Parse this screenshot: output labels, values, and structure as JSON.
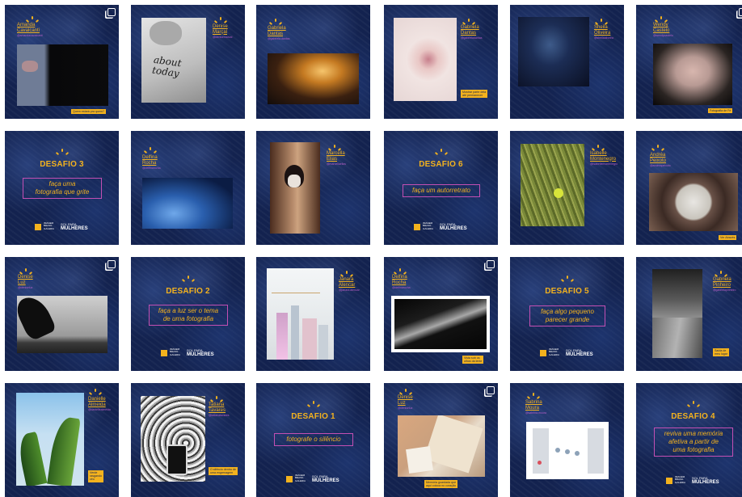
{
  "tiles": {
    "t1": {
      "name": "Amanda\nCavalcanti",
      "handle": "@amandacavalcanti",
      "caption": "Quem estará pra quem?"
    },
    "t2": {
      "name": "Denise\nMarçal",
      "handle": "@denisemarcal",
      "shirt_text": "about\ntoday"
    },
    "t3": {
      "name": "Gabriela\nDantas",
      "handle": "@gabriela.dantas"
    },
    "t4": {
      "name": "Gabriela\nDantas",
      "handle": "@gabrieladantas",
      "caption": "Mostrar parte dela\naté permanecer"
    },
    "t5": {
      "name": "Sheila\nOliveira",
      "handle": "@sheilaoliveira"
    },
    "t6": {
      "name": "Wendy\nCastelo",
      "handle": "@wendycastelo",
      "caption": "Fotografia de Fé"
    },
    "t7": {
      "title": "DESAFIO 3",
      "prompt": "faça uma\nfotografia que grite",
      "logo_left": "IMAGEM\nBRASIL\nGALERIA",
      "logo_right_small": "SOL PARA",
      "logo_right_big": "MULHERES"
    },
    "t8": {
      "name": "Delfina\nRocha",
      "handle": "@delfinarocha"
    },
    "t9": {
      "name": "Marcella\nElias",
      "handle": "@marcellaelias"
    },
    "t10": {
      "title": "DESAFIO 6",
      "prompt": "faça um autorretrato",
      "logo_left": "IMAGEM\nBRASIL\nGALERIA",
      "logo_right_small": "SOL PARA",
      "logo_right_big": "MULHERES"
    },
    "t11": {
      "name": "Isabelle\nMontenegro",
      "handle": "@isabellemontenegro"
    },
    "t12": {
      "name": "Andréa\nPeixoto",
      "handle": "@andreapeixoto",
      "caption": "Ver Através"
    },
    "t13": {
      "name": "Denise\nLuz",
      "handle": "@deniseluz"
    },
    "t14": {
      "title": "DESAFIO 2",
      "prompt": "faça a luz ser o tema\nde uma fotografia",
      "logo_left": "IMAGEM\nBRASIL\nGALERIA",
      "logo_right_small": "SOL PARA",
      "logo_right_big": "MULHERES"
    },
    "t15": {
      "name": "Janara\nAlencar",
      "handle": "@janara.alencar"
    },
    "t16": {
      "name": "Delfina\nRocha",
      "handle": "@delfinarocha",
      "caption": "Vista sob os\nolhos da lente"
    },
    "t17": {
      "title": "DESAFIO 5",
      "prompt": "faça algo pequeno\nparecer grande",
      "logo_left": "IMAGEM\nBRASIL\nGALERIA",
      "logo_right_small": "SOL PARA",
      "logo_right_big": "MULHERES"
    },
    "t18": {
      "name": "Gabriela\nPinheiro",
      "handle": "@gabrielapinheiro",
      "caption": "Saída de\nmeu lugar"
    },
    "t19": {
      "name": "Danielle\nAlmeida",
      "handle": "@daniellealmeida",
      "caption": "Verde\nrasgando\ncéu"
    },
    "t20": {
      "name": "Tatiana\nTavares",
      "handle": "@tatianatavares",
      "caption": "O silêncio dentro de\numa engrenagem"
    },
    "t21": {
      "title": "DESAFIO 1",
      "prompt": "fotografe o silêncio",
      "logo_left": "IMAGEM\nBRASIL\nGALERIA",
      "logo_right_small": "SOL PARA",
      "logo_right_big": "MULHERES"
    },
    "t22": {
      "name": "Denise\nLuz",
      "handle": "@deniseluz",
      "caption": "Memória guardada que\naqui coloca no coração"
    },
    "t23": {
      "name": "Sabrina\nMoura",
      "handle": "@sabrina.moura"
    },
    "t24": {
      "title": "DESAFIO 4",
      "prompt": "reviva uma memória\nafetiva a partir de\numa fotografia",
      "logo_left": "IMAGEM\nBRASIL\nGALERIA",
      "logo_right_small": "SOL PARA",
      "logo_right_big": "MULHERES"
    }
  },
  "icons": {
    "multi_post": "carousel-icon",
    "sun": "sun-rays-icon"
  },
  "colors": {
    "background": "#13224f",
    "accent": "#f3b21e",
    "frame": "#c34fb3"
  }
}
